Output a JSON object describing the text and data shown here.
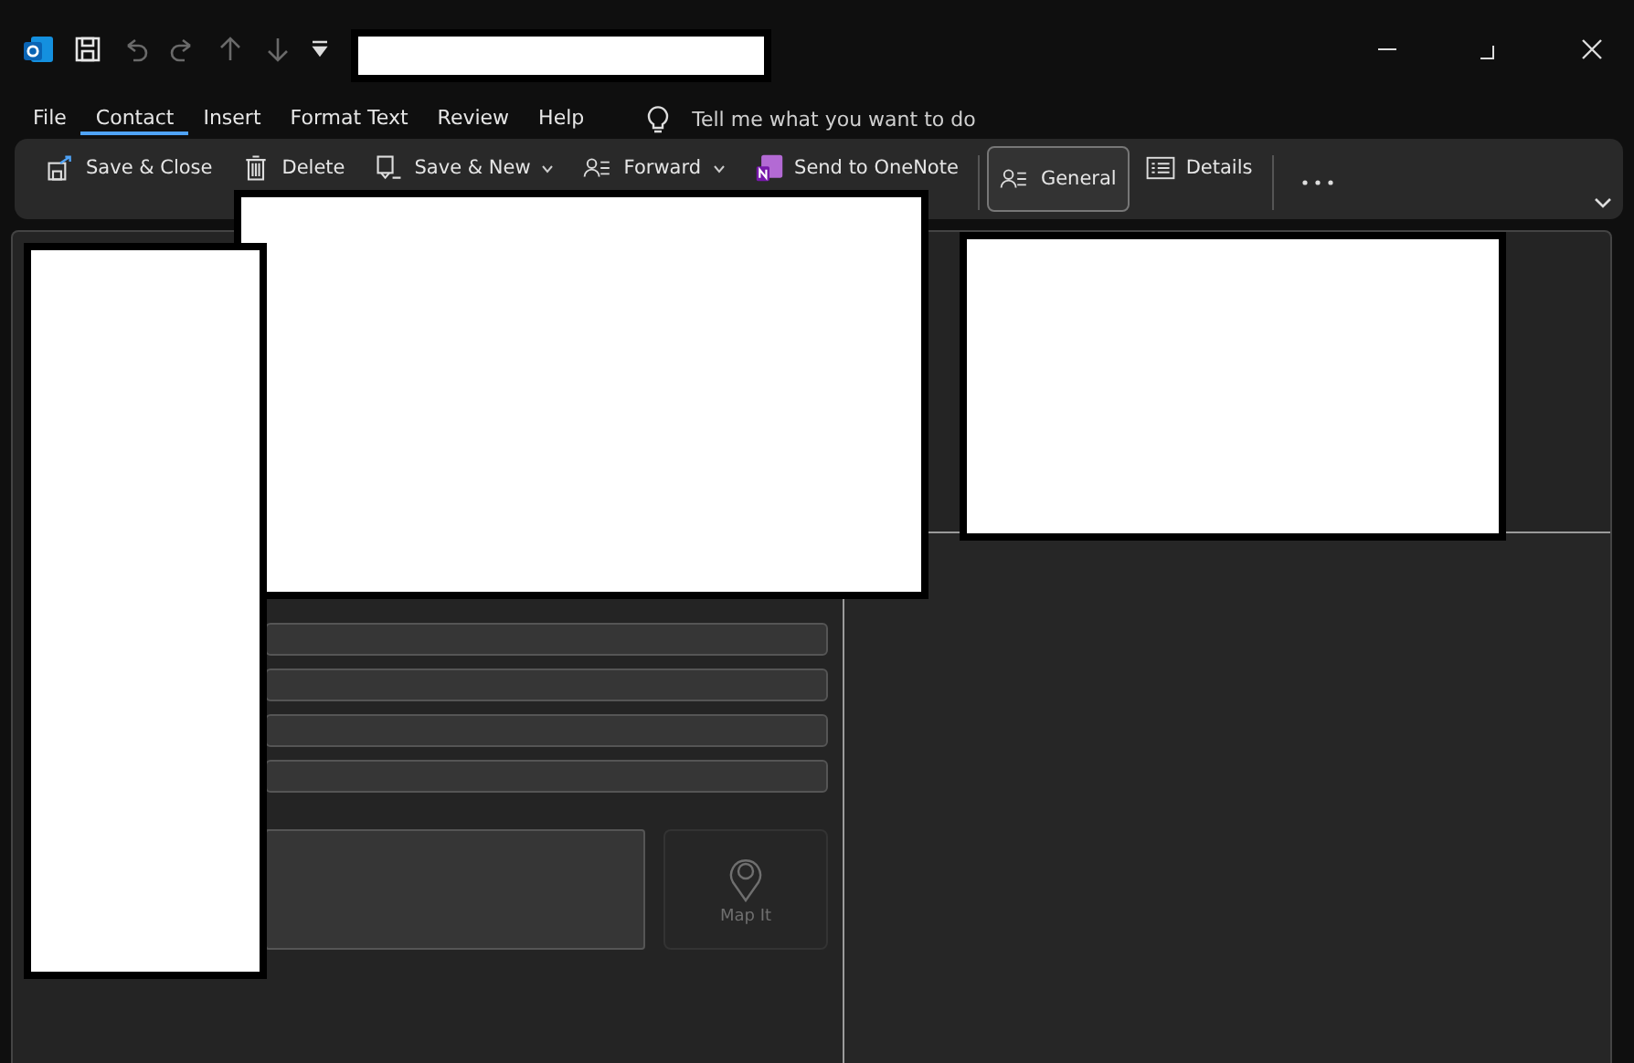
{
  "quick_access": [
    {
      "disabled": false
    },
    {
      "disabled": true
    },
    {
      "disabled": true
    },
    {
      "disabled": true
    },
    {
      "disabled": true
    }
  ],
  "menu_tabs": [
    {
      "label": "File",
      "selected": false
    },
    {
      "label": "Contact",
      "selected": true
    },
    {
      "label": "Insert",
      "selected": false
    },
    {
      "label": "Format Text",
      "selected": false
    },
    {
      "label": "Review",
      "selected": false
    },
    {
      "label": "Help",
      "selected": false
    }
  ],
  "tell_me": {
    "placeholder": "Tell me what you want to do"
  },
  "ribbon": [
    {
      "label": "Save & Close",
      "dropdown": false,
      "selected": false
    },
    {
      "label": "Delete",
      "dropdown": false,
      "selected": false
    },
    {
      "label": "Save & New",
      "dropdown": true,
      "selected": false
    },
    {
      "label": "Forward",
      "dropdown": true,
      "selected": false
    },
    {
      "label": "Send to OneNote",
      "dropdown": false,
      "selected": false
    },
    {
      "label": "General",
      "dropdown": false,
      "selected": true
    },
    {
      "label": "Details",
      "dropdown": false,
      "selected": false
    }
  ],
  "address_fields": [
    {
      "kind": "line"
    },
    {
      "kind": "line"
    },
    {
      "kind": "line"
    },
    {
      "kind": "line"
    },
    {
      "kind": "box"
    }
  ],
  "map_button": {
    "label": "Map It"
  }
}
